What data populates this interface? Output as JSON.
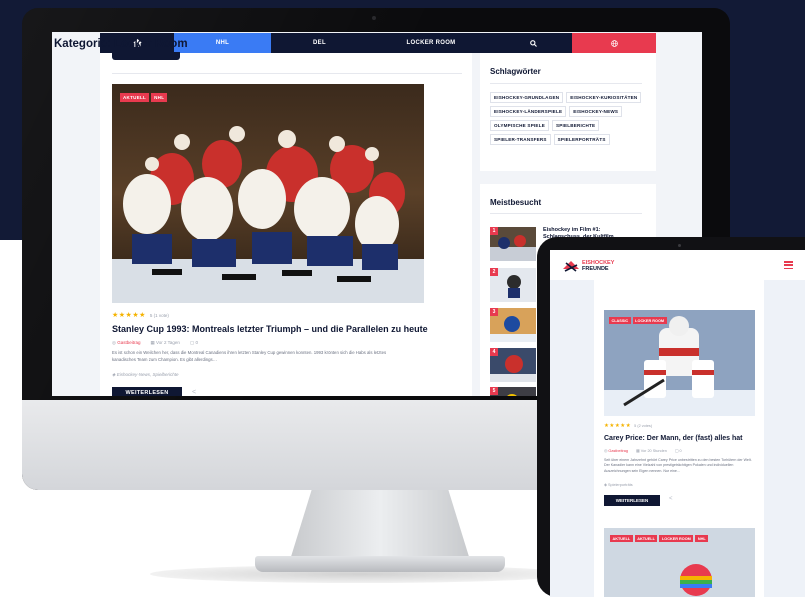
{
  "desktop": {
    "nav": {
      "home_icon": "home-icon",
      "items": [
        "NHL",
        "DEL",
        "LOCKER ROOM"
      ],
      "search_icon": "search-icon",
      "globe_icon": "globe-icon",
      "active_item": "NHL"
    },
    "article": {
      "badges": [
        "AKTUELL",
        "NHL"
      ],
      "stars": "★★★★★",
      "rating_text": "5 (1 vote)",
      "headline": "Stanley Cup 1993: Montreals letzter Triumph – und die Parallelen zu heute",
      "author": "Gastbeitrag",
      "date": "Vor 2 Tagen",
      "comments": "0",
      "excerpt": "Es ist schon ein Weilchen her, dass die Montreal Canadiens ihren letzten Stanley Cup gewinnen konnten. 1993 krönten sich die Habs als letztes kanadisches Team zum Champion. Es gibt allerdings…",
      "tags": "Eishockey-News, Spielberichte",
      "cta_label": "WEITERLESEN"
    },
    "sidebar": {
      "tags_title": "Schlagwörter",
      "tags": [
        "EISHOCKEY-GRUNDLAGEN",
        "EISHOCKEY-KURIOSITÄTEN",
        "EISHOCKEY-LÄNDERSPIELE",
        "EISHOCKEY-NEWS",
        "OLYMPISCHE SPIELE",
        "SPIELBERICHTE",
        "SPIELER-TRANSFERS",
        "SPIELERPORTRÄTS"
      ],
      "most_viewed_title": "Meistbesucht",
      "most_viewed": [
        {
          "rank": "1",
          "title": "Eishockey im Film #1: Schlagschuss, der Kultfilm"
        },
        {
          "rank": "2",
          "title": ""
        },
        {
          "rank": "3",
          "title": ""
        },
        {
          "rank": "4",
          "title": ""
        },
        {
          "rank": "5",
          "title": ""
        }
      ]
    }
  },
  "tablet": {
    "brand_line1": "EISHOCKEY",
    "brand_line2": "FREUNDE",
    "category_title": "Kategorie: Locker Room",
    "article": {
      "badges": [
        "CLASSIC",
        "LOCKER ROOM"
      ],
      "stars": "★★★★★",
      "rating_text": "5 (2 votes)",
      "headline": "Carey Price: Der Mann, der (fast) alles hat",
      "author": "Gastbeitrag",
      "date": "Vor 20 Stunden",
      "comments": "0",
      "excerpt": "Seit über einem Jahrzehnt gehört Carey Price unbestritten zu den besten Torhütern der Welt. Der Kanadier kann eine Vielzahl von prestigeträchtigen Pokalen und individuellen Auszeichnungen sein Eigen nennen. Nur eine…",
      "tags": "Spielerporträts",
      "cta_label": "WEITERLESEN"
    },
    "next_badges": [
      "AKTUELL",
      "AKTUELL",
      "LOCKER ROOM",
      "NHL"
    ]
  },
  "colors": {
    "navy": "#0f1733",
    "accent_blue": "#3a7bf4",
    "accent_red": "#e83a4f",
    "star": "#f5b301"
  }
}
